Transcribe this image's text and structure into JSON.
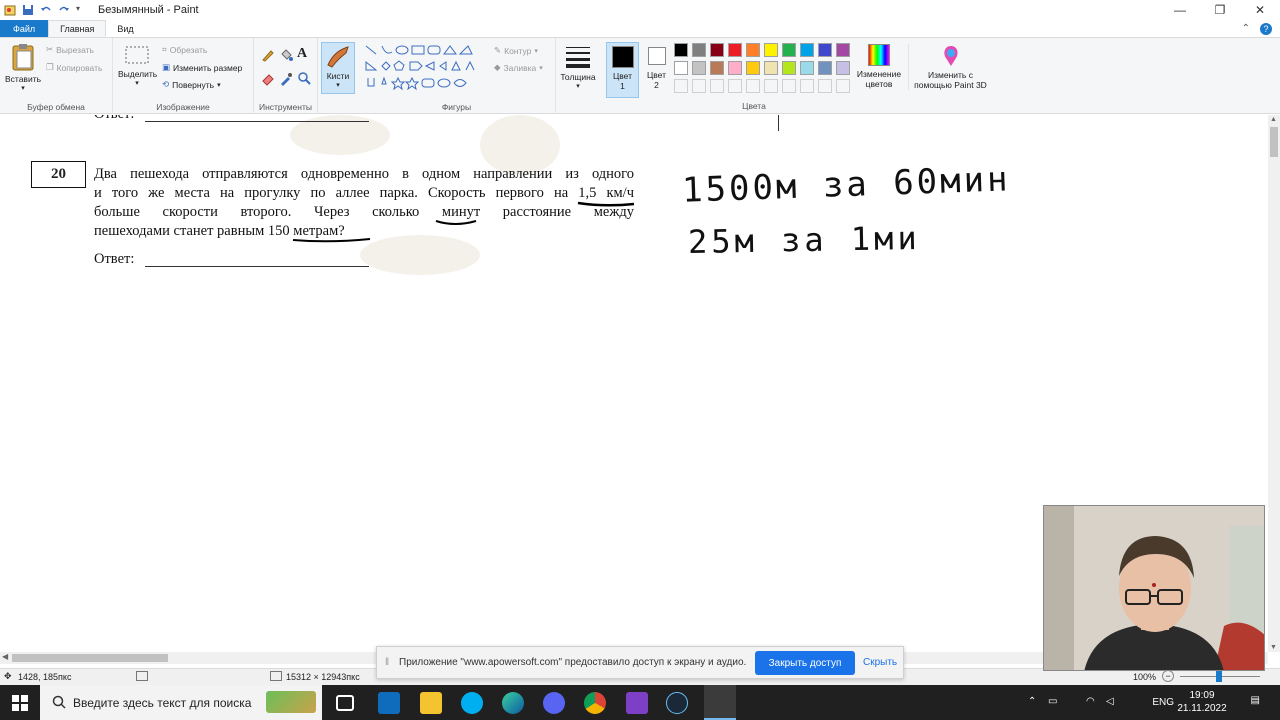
{
  "window": {
    "title": "Безымянный - Paint",
    "controls": [
      "minimize",
      "maximize",
      "close"
    ]
  },
  "tabs": [
    {
      "label": "Файл"
    },
    {
      "label": "Главная"
    },
    {
      "label": "Вид"
    }
  ],
  "ribbon": {
    "clipboard": {
      "paste": "Вставить",
      "cut": "Вырезать",
      "copy": "Копировать",
      "label": "Буфер обмена"
    },
    "image": {
      "select": "Выделить",
      "crop": "Обрезать",
      "resize": "Изменить размер",
      "rotate": "Повернуть",
      "label": "Изображение"
    },
    "tools": {
      "label": "Инструменты"
    },
    "brushes": {
      "label": "Кисти"
    },
    "shapes": {
      "outline": "Контур",
      "fill": "Заливка",
      "label": "Фигуры"
    },
    "thickness": {
      "label": "Толщина"
    },
    "color1": {
      "label": "Цвет",
      "num": "1"
    },
    "color2": {
      "label": "Цвет",
      "num": "2"
    },
    "colors": {
      "label": "Цвета",
      "edit": "Изменение цветов",
      "paint3d": "Изменить с помощью Paint 3D",
      "palette_row1": [
        "#000000",
        "#7f7f7f",
        "#880015",
        "#ed1c24",
        "#ff7f27",
        "#fff200",
        "#22b14c",
        "#00a2e8",
        "#3f48cc",
        "#a349a4"
      ],
      "palette_row2": [
        "#ffffff",
        "#c3c3c3",
        "#b97a57",
        "#ffaec9",
        "#ffc90e",
        "#efe4b0",
        "#b5e61d",
        "#99d9ea",
        "#7092be",
        "#c8bfe7"
      ]
    }
  },
  "document": {
    "problem_number": "20",
    "prev_answer_label": "Ответ:",
    "problem_lines": [
      "Два пешехода отправляются одновременно в одном направлении из одного",
      "и того же места на прогулку по аллее парка. Скорость первого на 1,5 км/ч",
      "больше скорости второго. Через сколько минут расстояние между",
      "пешеходами станет равным 150 метрам?"
    ],
    "answer_label": "Ответ:",
    "handwriting_line1": "1500м за 60мин",
    "handwriting_line2": "25м за 1ми"
  },
  "statusbar": {
    "cursor_pos": "1428, 185пкс",
    "canvas_size": "15312 × 12943пкс",
    "zoom": "100%"
  },
  "notification": {
    "message": "Приложение \"www.apowersoft.com\" предоставило доступ к экрану и аудио.",
    "close_access": "Закрыть доступ",
    "hide": "Скрыть"
  },
  "taskbar": {
    "search_placeholder": "Введите здесь текст для поиска",
    "lang": "ENG",
    "time": "19:09",
    "date": "21.11.2022"
  }
}
